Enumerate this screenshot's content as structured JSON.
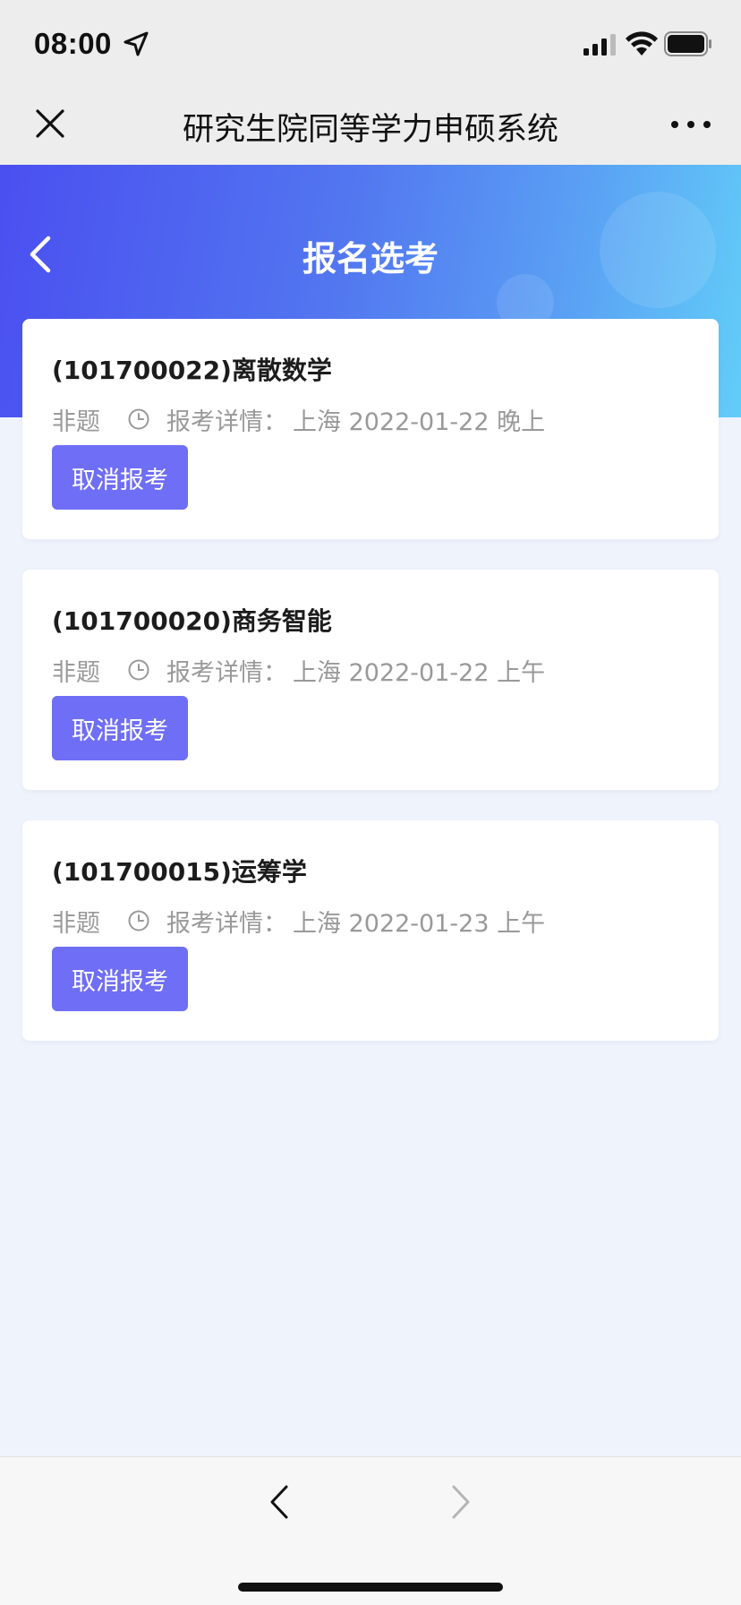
{
  "status_bar": {
    "time": "08:00",
    "icons": [
      "location-arrow-icon",
      "signal-icon",
      "wifi-icon",
      "battery-icon"
    ]
  },
  "nav_bar": {
    "title": "研究生院同等学力申硕系统",
    "icons": [
      "close-icon",
      "more-icon"
    ]
  },
  "header": {
    "title": "报名选考",
    "icons": [
      "back-icon"
    ],
    "gradient_colors": [
      "#4a4ff0",
      "#62cdf8"
    ]
  },
  "exams": [
    {
      "title": "(101700022)离散数学",
      "type": "非题",
      "detail_label": "报考详情：",
      "detail": "上海 2022-01-22 晚上",
      "button": "取消报考"
    },
    {
      "title": "(101700020)商务智能",
      "type": "非题",
      "detail_label": "报考详情：",
      "detail": "上海 2022-01-22 上午",
      "button": "取消报考"
    },
    {
      "title": "(101700015)运筹学",
      "type": "非题",
      "detail_label": "报考详情：",
      "detail": "上海 2022-01-23 上午",
      "button": "取消报考"
    }
  ],
  "bottom_bar": {
    "icons": [
      "browser-back-icon",
      "browser-forward-icon"
    ]
  },
  "colors": {
    "accent_button": "#6f6ef6",
    "background": "#eff3fc",
    "muted_text": "#999999"
  }
}
